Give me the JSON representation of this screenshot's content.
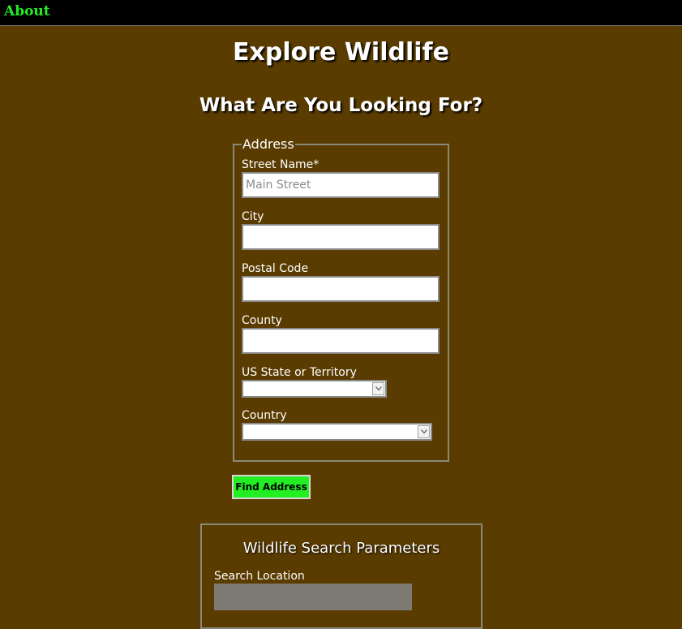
{
  "nav": {
    "about_label": "About"
  },
  "header": {
    "title": "Explore Wildlife",
    "subtitle": "What Are You Looking For?"
  },
  "address_form": {
    "legend": "Address",
    "street": {
      "label": "Street Name*",
      "placeholder": "Main Street",
      "value": ""
    },
    "city": {
      "label": "City",
      "value": ""
    },
    "postal": {
      "label": "Postal Code",
      "value": ""
    },
    "county": {
      "label": "County",
      "value": ""
    },
    "state": {
      "label": "US State or Territory",
      "selected": ""
    },
    "country": {
      "label": "Country",
      "selected": ""
    }
  },
  "find_button_label": "Find Address",
  "search_panel": {
    "title": "Wildlife Search Parameters",
    "location_label": "Search Location",
    "location_value": ""
  },
  "colors": {
    "page_background": "#5a3c00",
    "topbar_background": "#000000",
    "accent_green": "#22ee22",
    "disabled_gray": "#7d7a73"
  },
  "icons": {
    "dropdown_arrow": "chevron-down-icon"
  }
}
